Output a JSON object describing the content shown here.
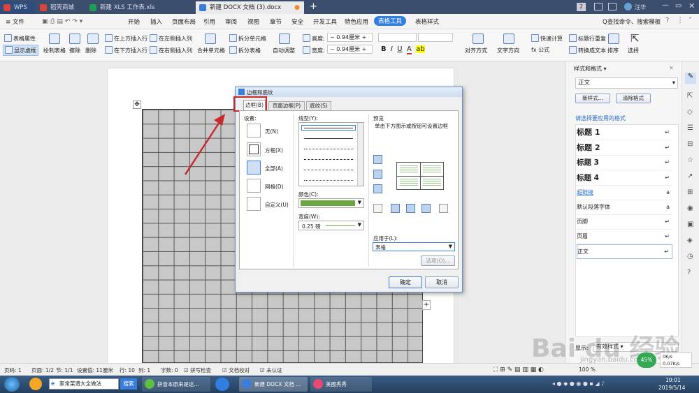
{
  "tabs": [
    {
      "label": "WPS",
      "color": "#d9443b"
    },
    {
      "label": "稻壳商城",
      "color": "#d9443b"
    },
    {
      "label": "新建 XLS 工作表.xls",
      "color": "#1f9d55"
    },
    {
      "label": "新建 DOCX 文档 (3).docx",
      "color": "#3b7ddd"
    }
  ],
  "titlebar_right": {
    "badge": "2",
    "user": "汪华"
  },
  "menus": [
    "≡ 文件",
    "开始",
    "插入",
    "页面布局",
    "引用",
    "审阅",
    "视图",
    "章节",
    "安全",
    "开发工具",
    "特色应用",
    "表格工具",
    "表格样式"
  ],
  "menu_search": "Q查找命令、搜索模板",
  "ribbon": {
    "table_props": "表格属性",
    "show_lines": "显示虚框",
    "draw_table": "绘制表格",
    "erase": "擦除",
    "delete": "删除",
    "insert_above": "在上方插入行",
    "insert_below": "在下方插入行",
    "insert_left": "在左侧插入列",
    "insert_right": "在右侧插入列",
    "merge": "合并单元格",
    "split_cell": "拆分单元格",
    "split_table": "拆分表格",
    "auto_fit": "自动调整",
    "height_label": "高度:",
    "height_val": "0.94厘米",
    "width_label": "宽度:",
    "width_val": "0.94厘米",
    "align": "对齐方式",
    "text_dir": "文字方向",
    "quick_calc": "快速计算",
    "formula": "fx 公式",
    "repeat_title": "标题行重复",
    "to_text": "转换成文本",
    "sort": "排序",
    "select": "选择"
  },
  "dialog": {
    "title": "边框和底纹",
    "tabs": [
      "边框(B)",
      "页面边框(P)",
      "底纹(S)"
    ],
    "settings_label": "设置:",
    "settings": [
      "无(N)",
      "方框(X)",
      "全部(A)",
      "网格(D)",
      "自定义(U)"
    ],
    "style_label": "线型(Y):",
    "color_label": "颜色(C):",
    "color_value": "#6aa83f",
    "width_label": "宽度(W):",
    "width_value": "0.25 磅",
    "preview_label": "预览",
    "preview_hint": "单击下方图示或按钮可设置边框",
    "apply_label": "应用于(L):",
    "apply_value": "表格",
    "options": "选项(O)...",
    "ok": "确定",
    "cancel": "取消"
  },
  "panel": {
    "title": "样式和格式 ▾",
    "current": "正文",
    "new_style": "新样式...",
    "clear": "清除格式",
    "apply_hint": "请选择要应用的格式",
    "styles": [
      "标题 1",
      "标题 2",
      "标题 3",
      "标题 4",
      "超链接",
      "默认段落字体",
      "页脚",
      "页眉",
      "正文"
    ],
    "show_label": "显示:",
    "show_value": "有效样式"
  },
  "status": {
    "page": "页码: 1",
    "pages": "页面: 1/2",
    "section": "节: 1/1",
    "setting": "设置值: 11厘米",
    "row": "行: 10",
    "col": "列: 1",
    "words": "字数: 0",
    "spell": "拼写检查",
    "doc_check": "文档校对",
    "cert": "未认证",
    "zoom": "100 %"
  },
  "taskbar": {
    "search": "家常菜谱大全做法",
    "search_btn": "搜索",
    "items": [
      "拼音本原来是这...",
      "新建 DOCX 文档 ...",
      "美图秀秀"
    ],
    "time": "10:01",
    "date": "2019/5/14",
    "net_up": "0K/s",
    "net_down": "0.07K/s",
    "cpu": "45%"
  },
  "watermark": "Bai du 经验",
  "watermark_url": "jingyan.baidu.com"
}
